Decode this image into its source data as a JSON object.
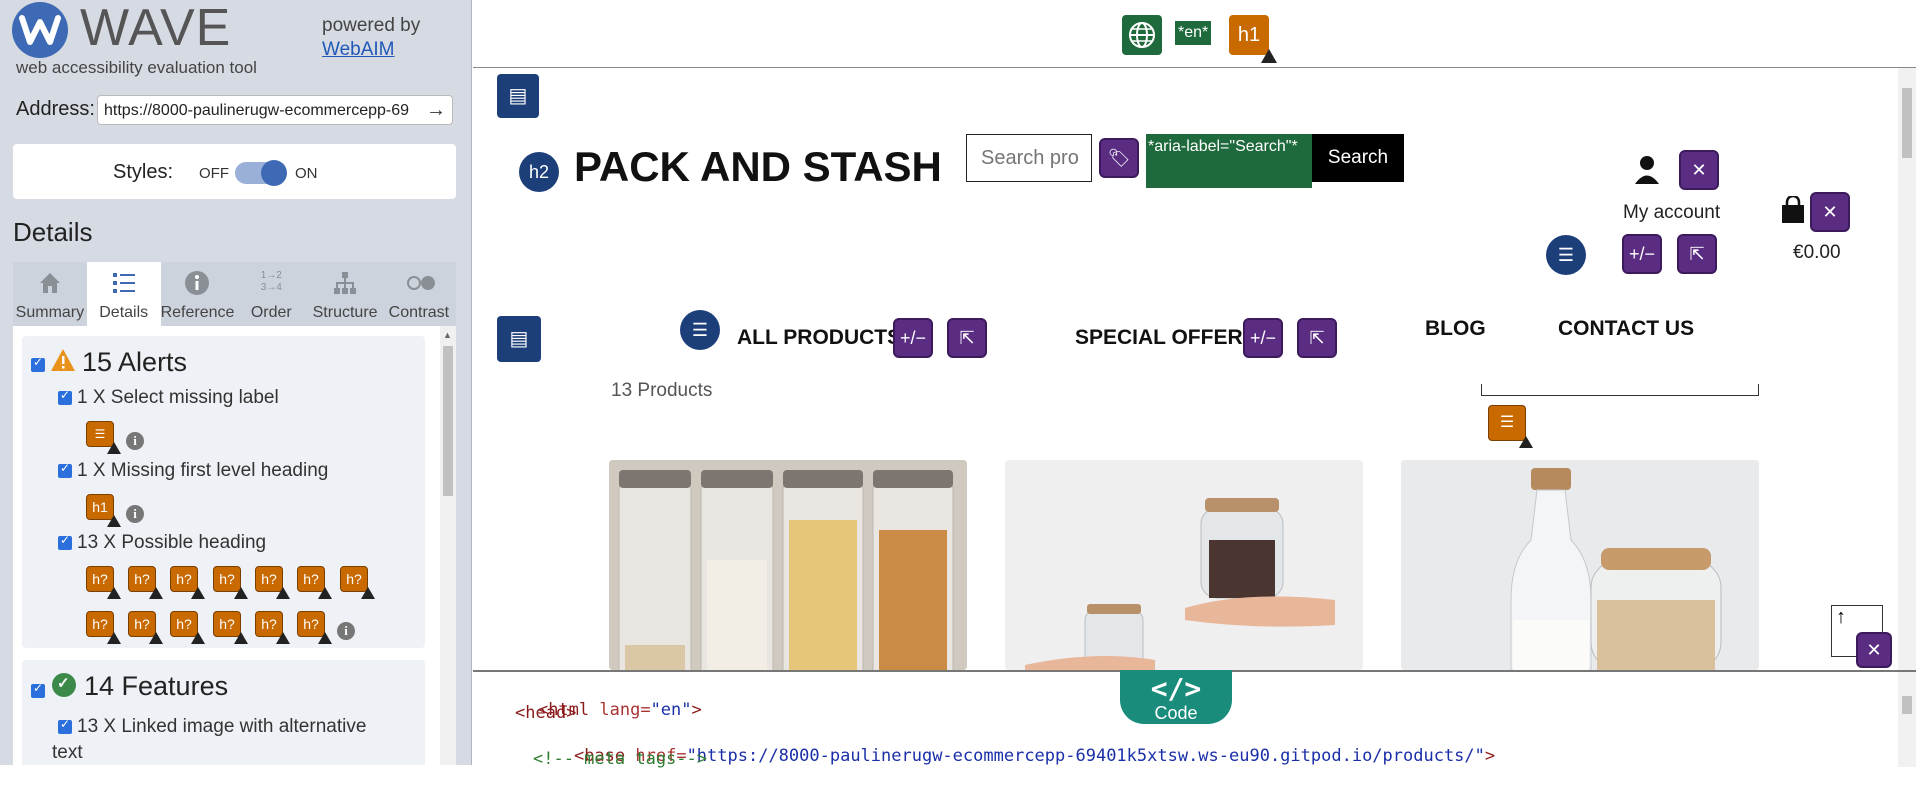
{
  "wave": {
    "logo_word": "WAVE",
    "logo_sub": "web accessibility evaluation tool",
    "powered_by": "powered by",
    "powered_link": "WebAIM",
    "address_label": "Address:",
    "address_value": "https://8000-paulinerugw-ecommercepp-69",
    "styles_label": "Styles:",
    "styles_off": "OFF",
    "styles_on": "ON",
    "details_title": "Details",
    "tabs": [
      {
        "label": "Summary",
        "icon": "home-icon"
      },
      {
        "label": "Details",
        "icon": "list-icon"
      },
      {
        "label": "Reference",
        "icon": "info-icon"
      },
      {
        "label": "Order",
        "icon": "order-icon"
      },
      {
        "label": "Structure",
        "icon": "structure-icon"
      },
      {
        "label": "Contrast",
        "icon": "contrast-icon"
      }
    ],
    "alerts": {
      "title": "15 Alerts",
      "items": [
        {
          "label": "1 X Select missing label"
        },
        {
          "label": "1 X Missing first level heading",
          "icon_text": "h1"
        },
        {
          "label": "13 X Possible heading",
          "icon_text": "h?"
        }
      ]
    },
    "features": {
      "title": "14 Features",
      "items": [
        {
          "label_line1": "13 X Linked image with alternative",
          "label_line2": "text"
        }
      ]
    }
  },
  "page": {
    "lang_chip": "*en*",
    "h1_icon": "h1",
    "h2_icon": "h2",
    "brand": "PACK AND STASH",
    "search_placeholder": "Search pro",
    "aria_chip": "*aria-label=\"Search\"*",
    "search_button": "Search",
    "account_label": "My account",
    "price": "€0.00",
    "nav": {
      "all_products": "ALL PRODUCTS",
      "special_offers": "SPECIAL OFFERS",
      "blog": "BLOG",
      "contact": "CONTACT US"
    },
    "products_count": "13 Products",
    "toggle_label": "+/−"
  },
  "code": {
    "tab_label": "Code",
    "tab_symbol": "</>",
    "line1_tag": "<html ",
    "line1_attr": "lang=",
    "line1_val": "\"en\"",
    "line1_end": ">",
    "line2": "<head>",
    "line3_tag": "<base ",
    "line3_attr": "href=",
    "line3_val": "\"https://8000-paulinerugw-ecommercepp-69401k5xtsw.ws-eu90.gitpod.io/products/\"",
    "line3_end": ">",
    "line4": "<!-- meta tags-->"
  },
  "colors": {
    "wave_blue": "#3e6ab5",
    "alert_orange": "#c86a00",
    "feature_green": "#3b8a4a",
    "aria_purple": "#5a2d82",
    "structure_navy": "#1c3f7a",
    "lang_green": "#1f6a3d",
    "code_teal": "#1a8c7c"
  }
}
